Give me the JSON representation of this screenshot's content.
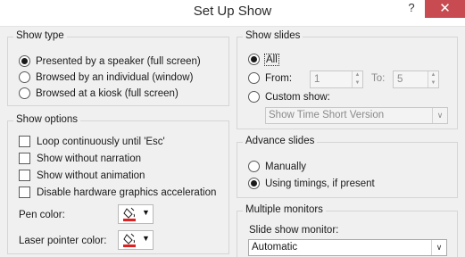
{
  "window": {
    "title": "Set Up Show",
    "help": "?",
    "close": "✕"
  },
  "show_type": {
    "title": "Show type",
    "options": [
      {
        "label": "Presented by a speaker (full screen)",
        "selected": true
      },
      {
        "label": "Browsed by an individual (window)",
        "selected": false
      },
      {
        "label": "Browsed at a kiosk (full screen)",
        "selected": false
      }
    ]
  },
  "show_options": {
    "title": "Show options",
    "checks": [
      {
        "label": "Loop continuously until 'Esc'",
        "checked": false
      },
      {
        "label": "Show without narration",
        "checked": false
      },
      {
        "label": "Show without animation",
        "checked": false
      },
      {
        "label": "Disable hardware graphics acceleration",
        "checked": false
      }
    ],
    "pen_color_label": "Pen color:",
    "laser_color_label": "Laser pointer color:",
    "pen_color": "#e02020",
    "laser_color": "#e02020"
  },
  "show_slides": {
    "title": "Show slides",
    "all_label": "All",
    "from_label": "From:",
    "from_value": "1",
    "to_label": "To:",
    "to_value": "5",
    "custom_label": "Custom show:",
    "custom_value": "Show Time Short Version"
  },
  "advance_slides": {
    "title": "Advance slides",
    "manual_label": "Manually",
    "timings_label": "Using timings, if present"
  },
  "monitors": {
    "title": "Multiple monitors",
    "monitor_label": "Slide show monitor:",
    "monitor_value": "Automatic"
  }
}
